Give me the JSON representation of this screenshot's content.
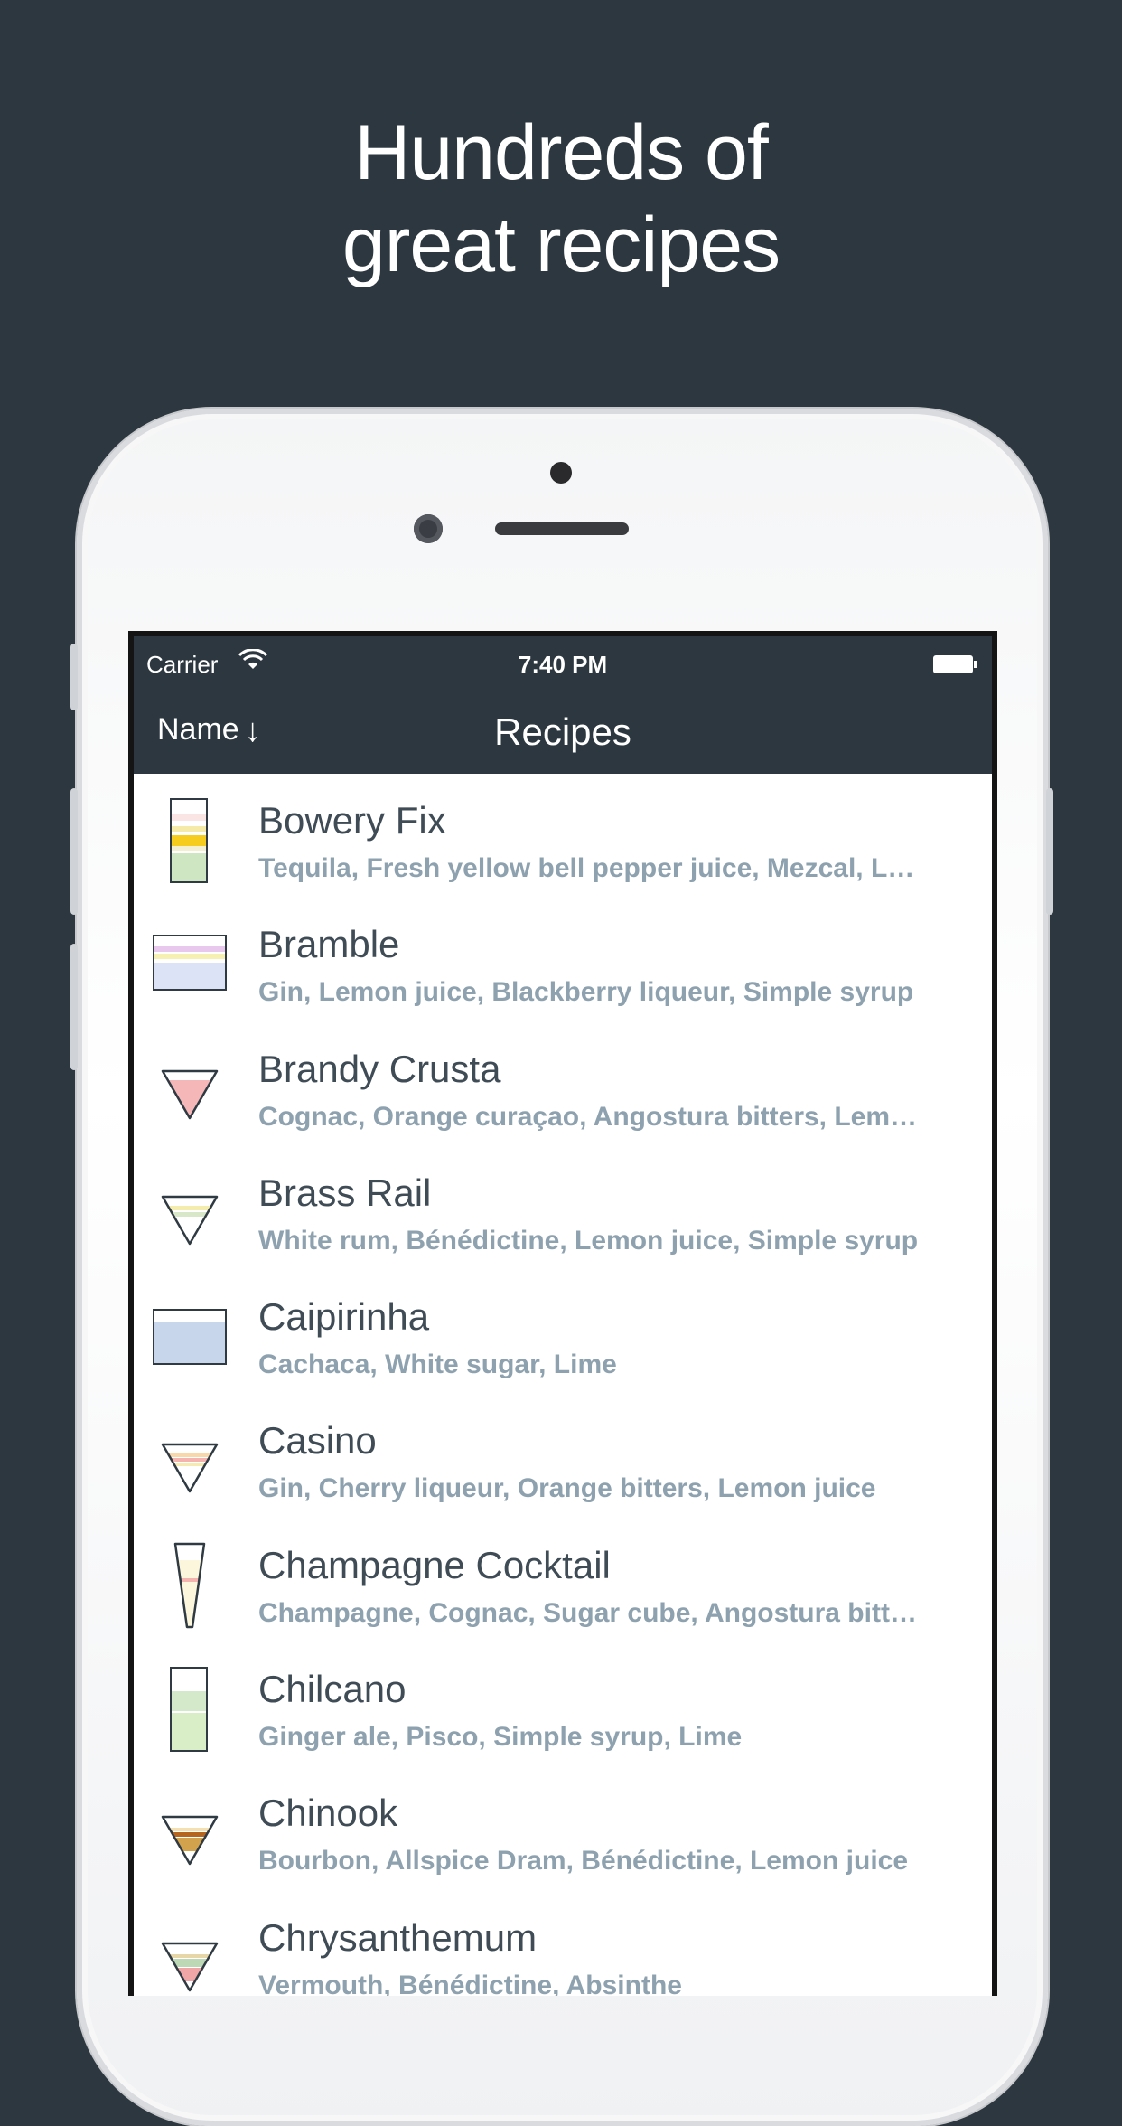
{
  "headline": {
    "line1": "Hundreds of",
    "line2": "great recipes"
  },
  "status_bar": {
    "carrier": "Carrier",
    "time": "7:40 PM"
  },
  "nav": {
    "sort_label": "Name",
    "sort_arrow": "↓",
    "title": "Recipes"
  },
  "colors": {
    "background": "#2c3740",
    "title_text": "#3f4c56",
    "subtitle_text": "#8ea1af"
  },
  "recipes": [
    {
      "name": "Bowery Fix",
      "ingredients": "Tequila, Fresh yellow bell pepper juice, Mezcal, L…",
      "glass": "highball-icon"
    },
    {
      "name": "Bramble",
      "ingredients": "Gin, Lemon juice, Blackberry liqueur, Simple syrup",
      "glass": "rocks-glass-icon"
    },
    {
      "name": "Brandy Crusta",
      "ingredients": "Cognac, Orange curaçao, Angostura bitters, Lem…",
      "glass": "cocktail-glass-icon"
    },
    {
      "name": "Brass Rail",
      "ingredients": "White rum, Bénédictine, Lemon juice, Simple syrup",
      "glass": "cocktail-glass-icon"
    },
    {
      "name": "Caipirinha",
      "ingredients": "Cachaca, White sugar, Lime",
      "glass": "rocks-glass-icon"
    },
    {
      "name": "Casino",
      "ingredients": "Gin, Cherry liqueur, Orange bitters, Lemon juice",
      "glass": "cocktail-glass-icon"
    },
    {
      "name": "Champagne Cocktail",
      "ingredients": "Champagne, Cognac, Sugar cube, Angostura bitt…",
      "glass": "flute-icon"
    },
    {
      "name": "Chilcano",
      "ingredients": "Ginger ale, Pisco, Simple syrup, Lime",
      "glass": "highball-icon"
    },
    {
      "name": "Chinook",
      "ingredients": "Bourbon, Allspice Dram, Bénédictine, Lemon juice",
      "glass": "cocktail-glass-icon"
    },
    {
      "name": "Chrysanthemum",
      "ingredients": "Vermouth, Bénédictine, Absinthe",
      "glass": "cocktail-glass-icon"
    }
  ]
}
